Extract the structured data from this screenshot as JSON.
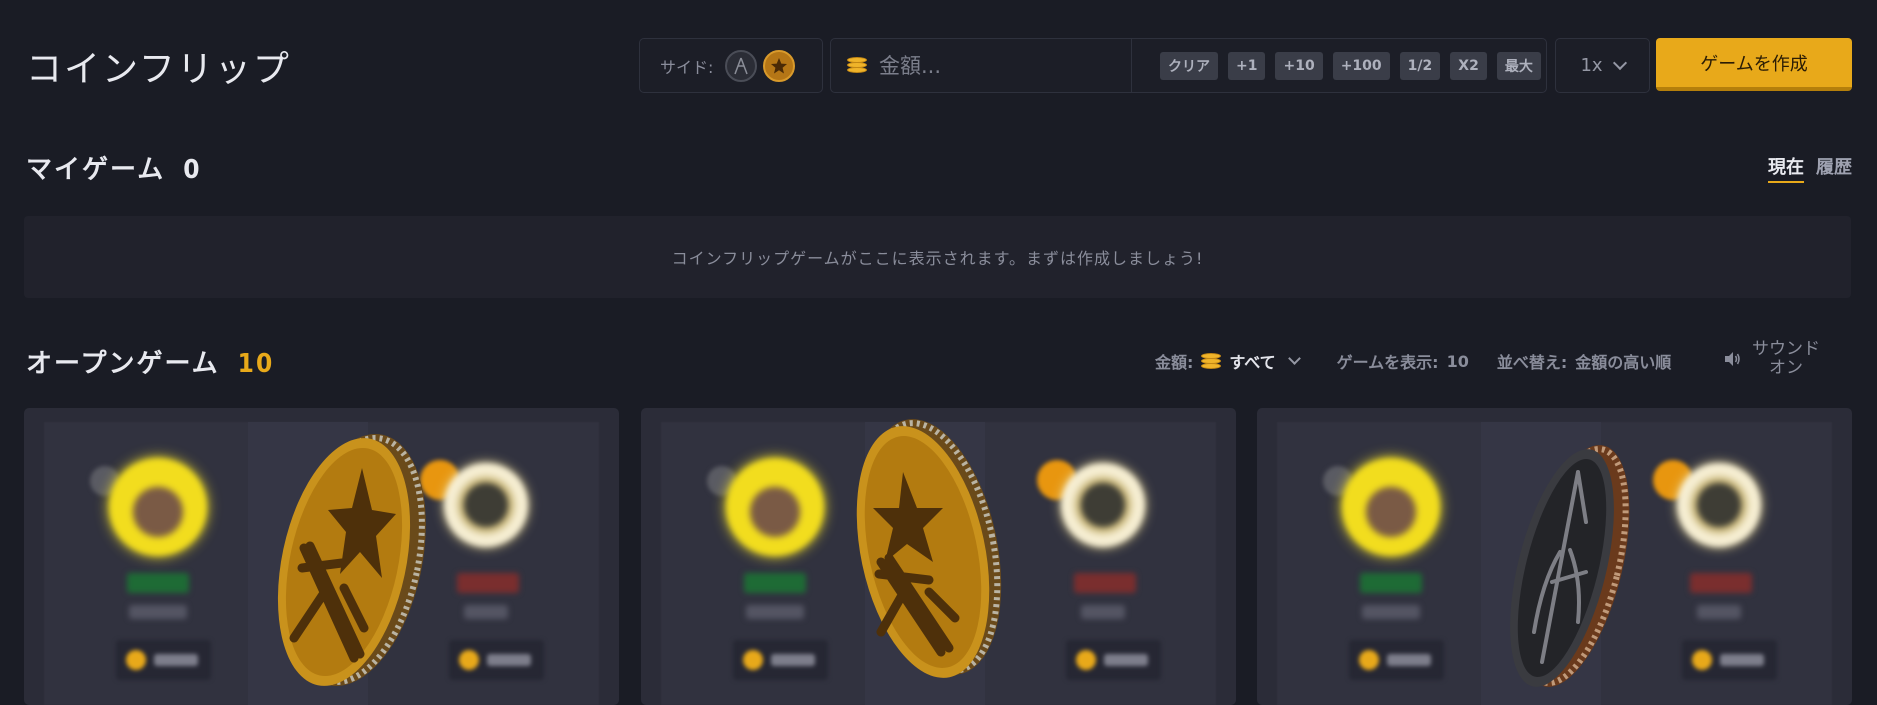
{
  "header": {
    "title": "コインフリップ",
    "side_label": "サイド:",
    "amount_placeholder": "金額...",
    "quick_buttons": [
      "クリア",
      "+1",
      "+10",
      "+100",
      "1/2",
      "X2",
      "最大"
    ],
    "multiplier": "1x",
    "create_button": "ゲームを作成"
  },
  "my_games": {
    "title": "マイゲーム",
    "count": "0",
    "tab_current": "現在",
    "tab_history": "履歴",
    "empty_message": "コインフリップゲームがここに表示されます。まずは作成しましょう!"
  },
  "open_games": {
    "title": "オープンゲーム",
    "count": "10",
    "filter_amount_label": "金額:",
    "filter_amount_value": "すべて",
    "show_label": "ゲームを表示:",
    "show_count": "10",
    "sort_label": "並べ替え:",
    "sort_value": "金額の高い順",
    "sound_line1": "サウンド",
    "sound_line2": "オン"
  },
  "cards": [
    {
      "coin_side": "t"
    },
    {
      "coin_side": "t"
    },
    {
      "coin_side": "ct"
    }
  ],
  "colors": {
    "accent": "#e8a91a",
    "background": "#1a1c25",
    "panel": "#21222c"
  }
}
